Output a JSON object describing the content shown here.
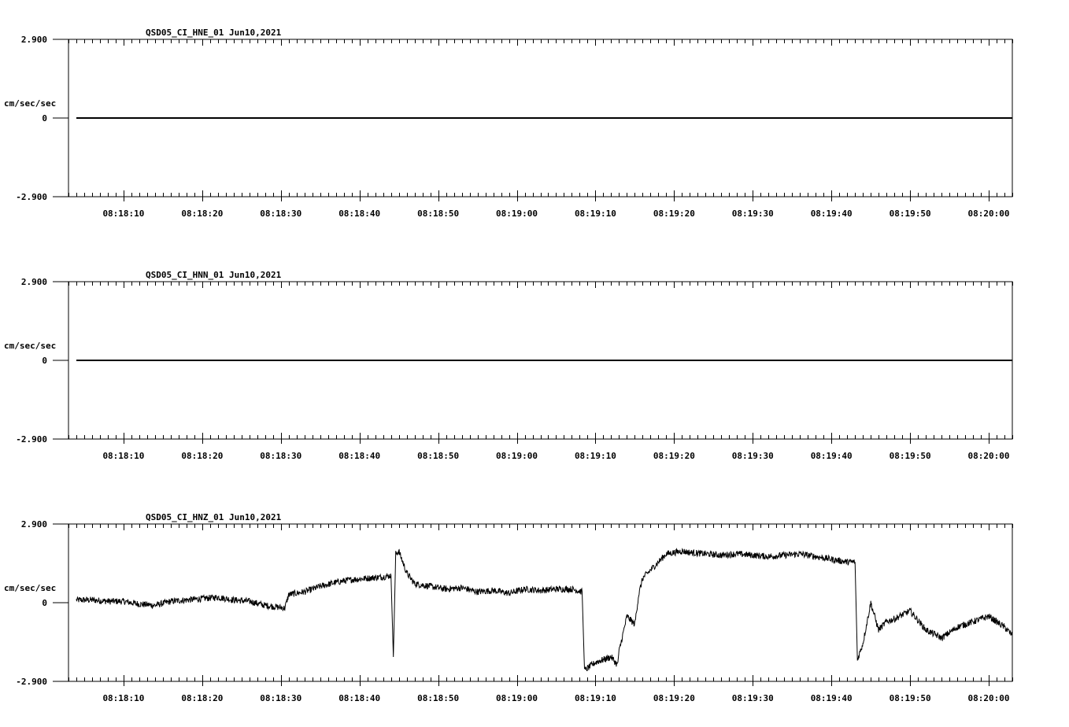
{
  "chart_data": [
    {
      "type": "line",
      "title": "QSD05_CI_HNE_01  Jun10,2021",
      "ylabel": "cm/sec/sec",
      "ylim": [
        -2.9,
        2.9
      ],
      "y_tick_labels": [
        "2.900",
        "0",
        "-2.900"
      ],
      "x_tick_labels": [
        "08:18:10",
        "08:18:20",
        "08:18:30",
        "08:18:40",
        "08:18:50",
        "08:19:00",
        "08:19:10",
        "08:19:20",
        "08:19:30",
        "08:19:40",
        "08:19:50",
        "08:20:00"
      ],
      "xlim": [
        "08:18:03",
        "08:20:03"
      ],
      "grid": false,
      "series": [
        {
          "x": [
            "08:18:04",
            "08:20:03"
          ],
          "y": [
            0,
            0
          ]
        }
      ]
    },
    {
      "type": "line",
      "title": "QSD05_CI_HNN_01  Jun10,2021",
      "ylabel": "cm/sec/sec",
      "ylim": [
        -2.9,
        2.9
      ],
      "y_tick_labels": [
        "2.900",
        "0",
        "-2.900"
      ],
      "x_tick_labels": [
        "08:18:10",
        "08:18:20",
        "08:18:30",
        "08:18:40",
        "08:18:50",
        "08:19:00",
        "08:19:10",
        "08:19:20",
        "08:19:30",
        "08:19:40",
        "08:19:50",
        "08:20:00"
      ],
      "xlim": [
        "08:18:03",
        "08:20:03"
      ],
      "grid": false,
      "series": [
        {
          "x": [
            "08:18:04",
            "08:20:03"
          ],
          "y": [
            0,
            0
          ]
        }
      ]
    },
    {
      "type": "line",
      "title": "QSD05_CI_HNZ_01  Jun10,2021",
      "ylabel": "cm/sec/sec",
      "ylim": [
        -2.9,
        2.9
      ],
      "y_tick_labels": [
        "2.900",
        "0",
        "-2.900"
      ],
      "x_tick_labels": [
        "08:18:10",
        "08:18:20",
        "08:18:30",
        "08:18:40",
        "08:18:50",
        "08:19:00",
        "08:19:10",
        "08:19:20",
        "08:19:30",
        "08:19:40",
        "08:19:50",
        "08:20:00"
      ],
      "xlim": [
        "08:18:03",
        "08:20:03"
      ],
      "grid": false,
      "series": [
        {
          "x": [
            "08:18:04",
            "08:18:06",
            "08:18:08",
            "08:18:10",
            "08:18:12",
            "08:18:14",
            "08:18:16",
            "08:18:18",
            "08:18:20",
            "08:18:22",
            "08:18:24",
            "08:18:26",
            "08:18:28",
            "08:18:30.5",
            "08:18:31",
            "08:18:33",
            "08:18:35",
            "08:18:37",
            "08:18:39",
            "08:18:41",
            "08:18:43",
            "08:18:44",
            "08:18:44.3",
            "08:18:44.6",
            "08:18:45",
            "08:18:46",
            "08:18:47",
            "08:18:49",
            "08:18:51",
            "08:18:53",
            "08:18:55",
            "08:18:57",
            "08:18:59",
            "08:19:01",
            "08:19:03",
            "08:19:05",
            "08:19:07",
            "08:19:08.3",
            "08:19:08.6",
            "08:19:10",
            "08:19:12",
            "08:19:12.8",
            "08:19:13",
            "08:19:14",
            "08:19:15",
            "08:19:15.5",
            "08:19:16",
            "08:19:17",
            "08:19:18",
            "08:19:19",
            "08:19:20",
            "08:19:21",
            "08:19:22",
            "08:19:24",
            "08:19:26",
            "08:19:28",
            "08:19:30",
            "08:19:32",
            "08:19:34",
            "08:19:36",
            "08:19:38",
            "08:19:40",
            "08:19:42",
            "08:19:43",
            "08:19:43.3",
            "08:19:44",
            "08:19:45",
            "08:19:46",
            "08:19:47",
            "08:19:48",
            "08:19:50",
            "08:19:52",
            "08:19:54",
            "08:19:56",
            "08:19:58",
            "08:20:00",
            "08:20:02",
            "08:20:03"
          ],
          "y": [
            0.1,
            0.1,
            0.05,
            0.05,
            -0.05,
            -0.1,
            0.05,
            0.1,
            0.15,
            0.2,
            0.1,
            0.05,
            -0.1,
            -0.2,
            0.3,
            0.4,
            0.6,
            0.75,
            0.85,
            0.9,
            0.95,
            1.0,
            -2.0,
            1.8,
            1.9,
            1.1,
            0.7,
            0.6,
            0.5,
            0.55,
            0.4,
            0.45,
            0.35,
            0.5,
            0.45,
            0.5,
            0.5,
            0.4,
            -2.5,
            -2.2,
            -2.0,
            -2.3,
            -1.8,
            -0.5,
            -0.8,
            0.3,
            0.9,
            1.2,
            1.5,
            1.8,
            1.85,
            1.9,
            1.85,
            1.8,
            1.75,
            1.8,
            1.75,
            1.7,
            1.75,
            1.8,
            1.7,
            1.6,
            1.5,
            1.5,
            -2.1,
            -1.5,
            0.0,
            -1.0,
            -0.7,
            -0.6,
            -0.3,
            -1.0,
            -1.3,
            -0.9,
            -0.7,
            -0.5,
            -0.9,
            -1.2
          ]
        }
      ]
    }
  ]
}
